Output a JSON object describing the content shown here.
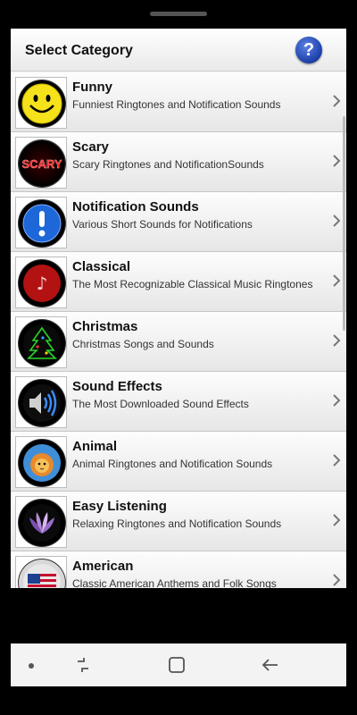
{
  "header": {
    "title": "Select Category",
    "help_icon": "question-mark-icon",
    "help_symbol": "?"
  },
  "categories": [
    {
      "title": "Funny",
      "subtitle": "Funniest Ringtones and Notification Sounds",
      "icon": "smiley-face-icon"
    },
    {
      "title": "Scary",
      "subtitle": "Scary Ringtones and NotificationSounds",
      "icon": "scary-text-icon",
      "icon_text": "SCARY"
    },
    {
      "title": "Notification Sounds",
      "subtitle": "Various Short Sounds for Notifications",
      "icon": "exclamation-icon"
    },
    {
      "title": "Classical",
      "subtitle": "The Most Recognizable Classical Music Ringtones",
      "icon": "music-note-icon"
    },
    {
      "title": "Christmas",
      "subtitle": "Christmas Songs and Sounds",
      "icon": "christmas-tree-icon"
    },
    {
      "title": "Sound Effects",
      "subtitle": "The Most Downloaded Sound Effects",
      "icon": "speaker-icon"
    },
    {
      "title": "Animal",
      "subtitle": "Animal Ringtones and Notification Sounds",
      "icon": "lion-icon"
    },
    {
      "title": "Easy Listening",
      "subtitle": "Relaxing Ringtones and Notification Sounds",
      "icon": "flower-icon"
    },
    {
      "title": "American",
      "subtitle": "Classic American Anthems and Folk Songs",
      "icon": "us-flag-icon"
    }
  ],
  "navbar": {
    "buttons": [
      "dot-icon",
      "recent-apps-icon",
      "home-icon",
      "back-icon"
    ]
  }
}
